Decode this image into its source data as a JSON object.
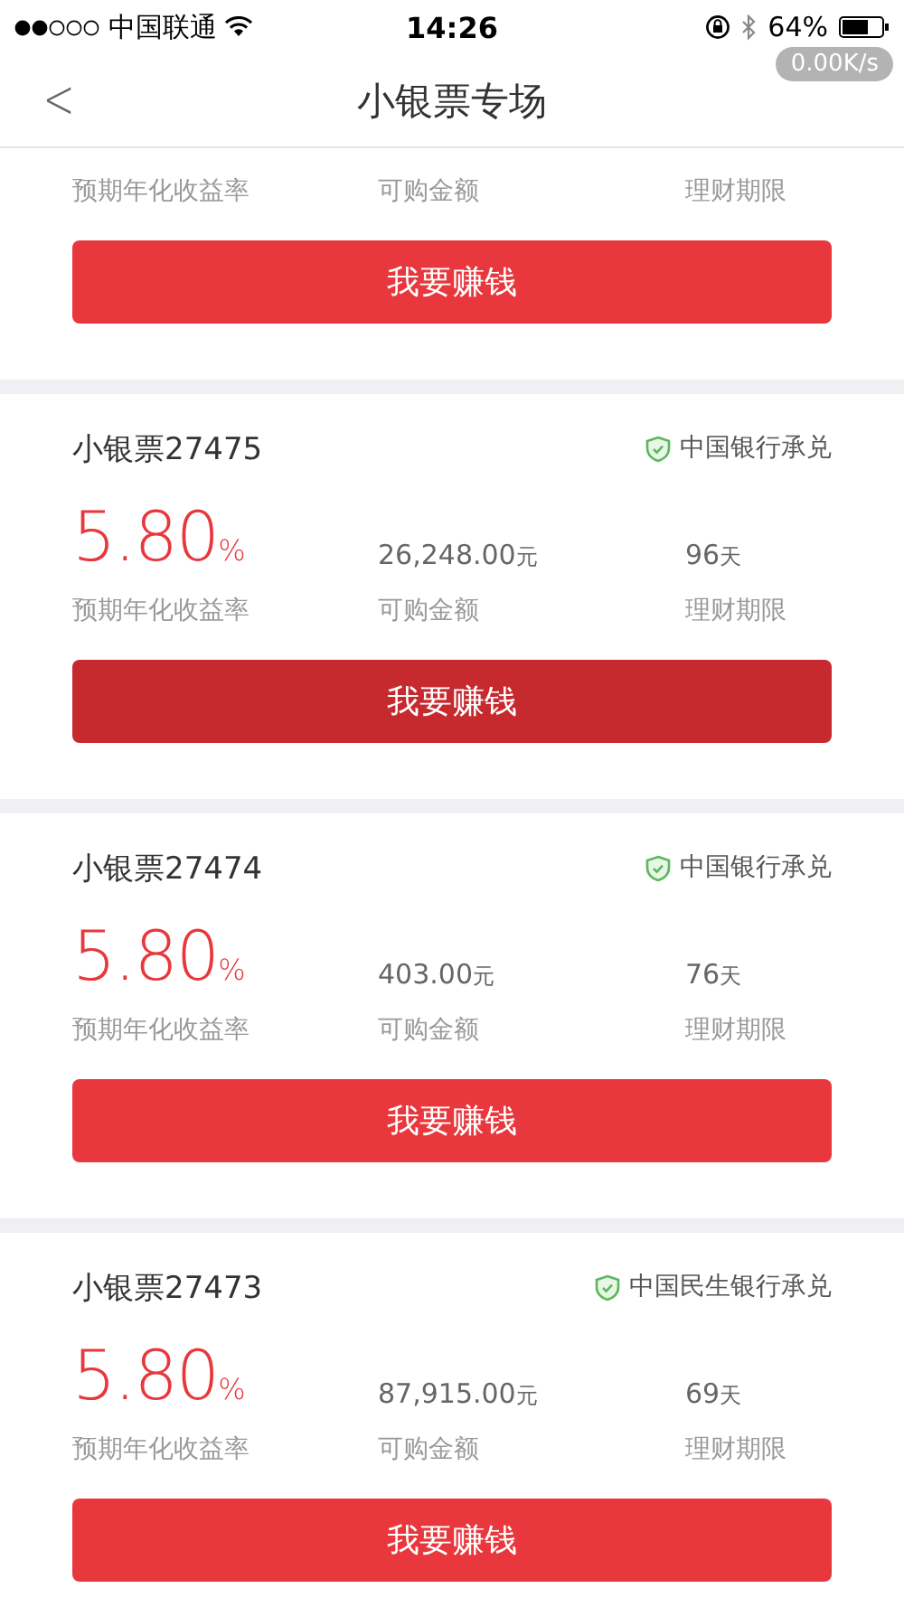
{
  "status_bar": {
    "carrier": "中国联通",
    "time": "14:26",
    "battery": "64%",
    "net_speed": "0.00K/s"
  },
  "nav": {
    "back": "<",
    "title": "小银票专场"
  },
  "partial_card": {
    "labels": [
      "预期年化收益率",
      "可购金额",
      "理财期限"
    ],
    "button": {
      "label": "我要赚钱",
      "pressed": false
    }
  },
  "cards": [
    {
      "name": "小银票27475",
      "guarantor": "中国银行承兑",
      "rate": "5.80",
      "rate_unit": "%",
      "amount": "26,248.00",
      "amount_unit": "元",
      "term": "96",
      "term_unit": "天",
      "labels": [
        "预期年化收益率",
        "可购金额",
        "理财期限"
      ],
      "button": {
        "label": "我要赚钱",
        "pressed": true
      }
    },
    {
      "name": "小银票27474",
      "guarantor": "中国银行承兑",
      "rate": "5.80",
      "rate_unit": "%",
      "amount": "403.00",
      "amount_unit": "元",
      "term": "76",
      "term_unit": "天",
      "labels": [
        "预期年化收益率",
        "可购金额",
        "理财期限"
      ],
      "button": {
        "label": "我要赚钱",
        "pressed": false
      }
    },
    {
      "name": "小银票27473",
      "guarantor": "中国民生银行承兑",
      "rate": "5.80",
      "rate_unit": "%",
      "amount": "87,915.00",
      "amount_unit": "元",
      "term": "69",
      "term_unit": "天",
      "labels": [
        "预期年化收益率",
        "可购金额",
        "理财期限"
      ],
      "button": {
        "label": "我要赚钱",
        "pressed": false
      }
    }
  ]
}
